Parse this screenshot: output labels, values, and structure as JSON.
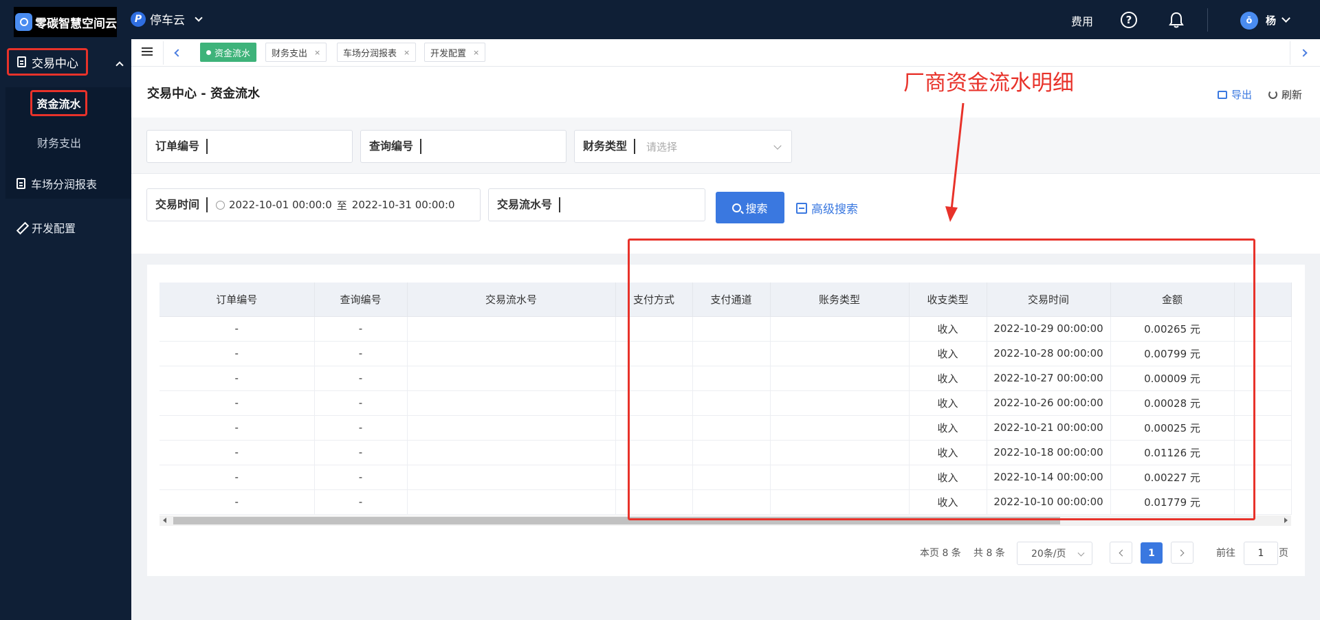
{
  "header": {
    "logo_text": "零碳智慧空间云",
    "product_name": "停车云",
    "fee_link": "费用",
    "help_icon": "?",
    "user_name": "杨",
    "avatar_glyph": "ō"
  },
  "sidebar": {
    "group_label": "交易中心",
    "sub_items": [
      "资金流水",
      "财务支出"
    ],
    "items": [
      "车场分润报表",
      "开发配置"
    ]
  },
  "tabs": [
    {
      "label": "资金流水",
      "active": true
    },
    {
      "label": "财务支出",
      "close": "×"
    },
    {
      "label": "车场分润报表",
      "close": "×"
    },
    {
      "label": "开发配置",
      "close": "×"
    }
  ],
  "page": {
    "title": "交易中心 - 资金流水",
    "export_label": "导出",
    "refresh_label": "刷新",
    "annotation": "厂商资金流水明细"
  },
  "filters": {
    "order_no_label": "订单编号",
    "query_no_label": "查询编号",
    "finance_type_label": "财务类型",
    "finance_type_placeholder": "请选择",
    "trade_time_label": "交易时间",
    "trade_time_start": "2022-10-01 00:00:0",
    "trade_time_sep": "至",
    "trade_time_end": "2022-10-31 00:00:0",
    "trade_serial_label": "交易流水号",
    "search_button": "搜索",
    "advanced_search": "高级搜索"
  },
  "table": {
    "columns": [
      "订单编号",
      "查询编号",
      "交易流水号",
      "支付方式",
      "支付通道",
      "账务类型",
      "收支类型",
      "交易时间",
      "金额",
      ""
    ],
    "rows": [
      [
        "-",
        "-",
        "",
        "",
        "",
        "",
        "收入",
        "2022-10-29 00:00:00",
        "0.00265 元",
        ""
      ],
      [
        "-",
        "-",
        "",
        "",
        "",
        "",
        "收入",
        "2022-10-28 00:00:00",
        "0.00799 元",
        ""
      ],
      [
        "-",
        "-",
        "",
        "",
        "",
        "",
        "收入",
        "2022-10-27 00:00:00",
        "0.00009 元",
        ""
      ],
      [
        "-",
        "-",
        "",
        "",
        "",
        "",
        "收入",
        "2022-10-26 00:00:00",
        "0.00028 元",
        ""
      ],
      [
        "-",
        "-",
        "",
        "",
        "",
        "",
        "收入",
        "2022-10-21 00:00:00",
        "0.00025 元",
        ""
      ],
      [
        "-",
        "-",
        "",
        "",
        "",
        "",
        "收入",
        "2022-10-18 00:00:00",
        "0.01126 元",
        ""
      ],
      [
        "-",
        "-",
        "",
        "",
        "",
        "",
        "收入",
        "2022-10-14 00:00:00",
        "0.00227 元",
        ""
      ],
      [
        "-",
        "-",
        "",
        "",
        "",
        "",
        "收入",
        "2022-10-10 00:00:00",
        "0.01779 元",
        ""
      ]
    ]
  },
  "pagination": {
    "page_count_text": "本页 8 条",
    "total_text": "共 8 条",
    "page_size": "20条/页",
    "current_page": "1",
    "goto_prefix": "前往",
    "goto_value": "1",
    "goto_suffix": "页"
  },
  "colors": {
    "nav_bg": "#0f1f36",
    "accent": "#3a78e0",
    "active_tab": "#3eb37a",
    "annotation_red": "#e8322a"
  }
}
